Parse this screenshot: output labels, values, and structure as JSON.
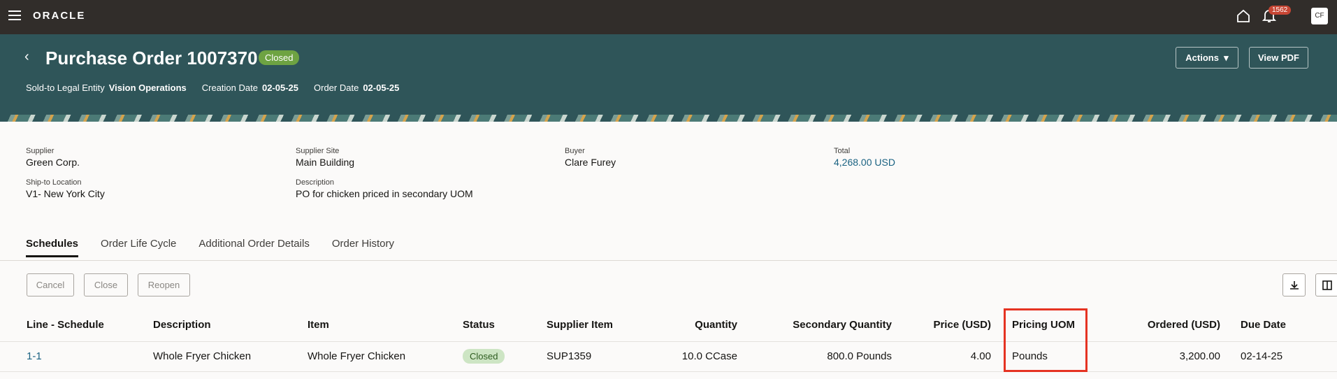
{
  "topbar": {
    "logo": "ORACLE",
    "notification_count": "1562",
    "avatar_initials": "CF"
  },
  "header": {
    "title": "Purchase Order 1007370",
    "status": "Closed",
    "sold_to_label": "Sold-to Legal Entity",
    "sold_to_value": "Vision Operations",
    "creation_label": "Creation Date",
    "creation_value": "02-05-25",
    "order_label": "Order Date",
    "order_value": "02-05-25",
    "actions_label": "Actions",
    "view_pdf_label": "View PDF"
  },
  "details": {
    "supplier_label": "Supplier",
    "supplier_value": "Green Corp.",
    "supplier_site_label": "Supplier Site",
    "supplier_site_value": "Main Building",
    "buyer_label": "Buyer",
    "buyer_value": "Clare Furey",
    "total_label": "Total",
    "total_value": "4,268.00 USD",
    "ship_to_label": "Ship-to Location",
    "ship_to_value": "V1- New York City",
    "description_label": "Description",
    "description_value": "PO for chicken priced in secondary UOM"
  },
  "tabs": [
    "Schedules",
    "Order Life Cycle",
    "Additional Order Details",
    "Order History"
  ],
  "toolbar": {
    "cancel": "Cancel",
    "close": "Close",
    "reopen": "Reopen"
  },
  "table": {
    "headers": [
      "Line - Schedule",
      "Description",
      "Item",
      "Status",
      "Supplier Item",
      "Quantity",
      "Secondary Quantity",
      "Price (USD)",
      "Pricing UOM",
      "Ordered (USD)",
      "Due Date"
    ],
    "rows": [
      {
        "line": "1-1",
        "description": "Whole Fryer Chicken",
        "item": "Whole Fryer Chicken",
        "status": "Closed",
        "supplier_item": "SUP1359",
        "quantity": "10.0 CCase",
        "secondary_quantity": "800.0 Pounds",
        "price": "4.00",
        "pricing_uom": "Pounds",
        "ordered": "3,200.00",
        "due_date": "02-14-25"
      }
    ]
  },
  "colors": {
    "header_bg": "#2f5559",
    "topbar_bg": "#312d2a",
    "link": "#1a6282",
    "highlight": "#e53322"
  }
}
